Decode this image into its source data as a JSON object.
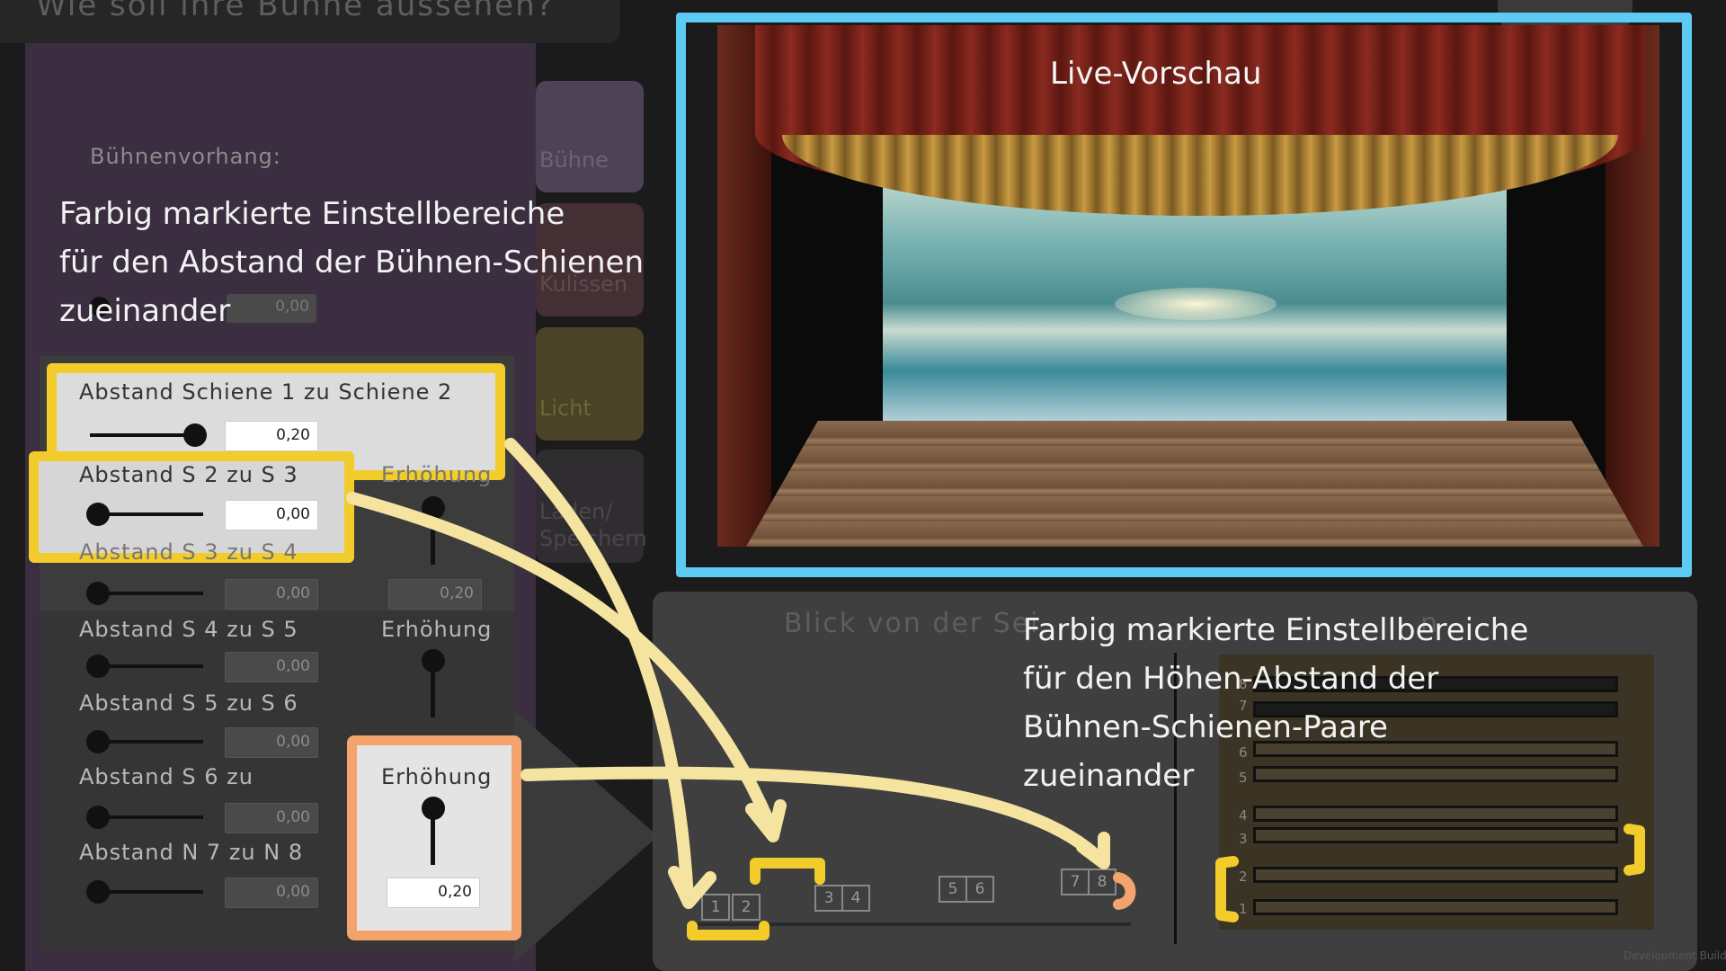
{
  "header": {
    "title": "Wie soll ihre Bühne aussehen?"
  },
  "tabs": [
    {
      "label": "Bühne"
    },
    {
      "label": "Kulissen"
    },
    {
      "label": "Licht"
    },
    {
      "label": "Laden/ Speichern"
    }
  ],
  "settings": {
    "curtain_label": "Bühnenvorhang:",
    "curtain_value": "0,00",
    "rows": [
      {
        "label": "Abstand Schiene 1 zu Schiene 2",
        "value": "0,20",
        "slider_fraction": 1.0
      },
      {
        "label": "Abstand S 2 zu S 3",
        "value": "0,00",
        "slider_fraction": 0.0
      },
      {
        "label": "Abstand S 3 zu S 4",
        "value": "0,00",
        "slider_fraction": 0.0
      },
      {
        "label": "Abstand S 4 zu S 5",
        "value": "0,00",
        "slider_fraction": 0.0
      },
      {
        "label": "Abstand S 5 zu S 6",
        "value": "0,00",
        "slider_fraction": 0.0
      },
      {
        "label": "Abstand S 6 zu",
        "value": "0,00",
        "slider_fraction": 0.0
      },
      {
        "label": "Abstand N 7 zu N 8",
        "value": "0,00",
        "slider_fraction": 0.0
      }
    ],
    "elevation": [
      {
        "label": "Erhöhung",
        "value": "0,20"
      },
      {
        "label": "Erhöhung",
        "value": ""
      },
      {
        "label": "Erhöhung",
        "value": "0,20"
      }
    ]
  },
  "annotations": {
    "rails_text": [
      "Farbig markierte Einstellbereiche",
      "für den Abstand der Bühnen-Schienen",
      "zueinander"
    ],
    "height_text": [
      "Farbig markierte Einstellbereiche",
      "für den Höhen-Abstand der",
      "Bühnen-Schienen-Paare",
      "zueinander"
    ],
    "preview_label": "Live-Vorschau"
  },
  "bottom_views": {
    "side_view_title": "Blick von der Sei",
    "top_view_title": "n",
    "rail_pairs": [
      "1",
      "2",
      "3",
      "4",
      "5",
      "6",
      "7",
      "8"
    ],
    "top_rail_numbers": [
      "8",
      "7",
      "6",
      "5",
      "4",
      "3",
      "2",
      "1"
    ]
  },
  "footer": {
    "dev_build": "Development Build"
  },
  "colors": {
    "preview_border": "#5ccaf2",
    "highlight_yellow": "#f2cc2a",
    "highlight_orange": "#f3a46c",
    "arrow": "#f5e3a0"
  }
}
